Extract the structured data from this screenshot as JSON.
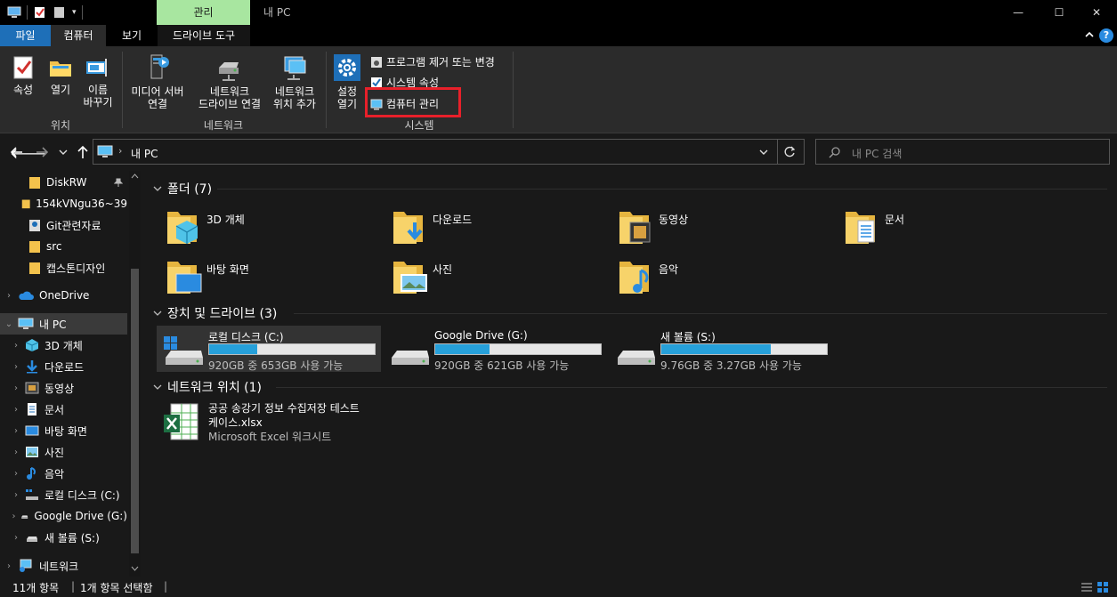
{
  "titlebar": {
    "manage_tab": "관리",
    "window_title": "내 PC",
    "minimize": "—",
    "maximize": "☐",
    "close": "✕"
  },
  "tabs": {
    "file": "파일",
    "computer": "컴퓨터",
    "view": "보기",
    "drive_tools": "드라이브 도구"
  },
  "ribbon": {
    "properties": "속성",
    "open": "열기",
    "rename_1": "이름",
    "rename_2": "바꾸기",
    "group_location": "위치",
    "media_server_1": "미디어 서버",
    "media_server_2": "연결",
    "network_drive_1": "네트워크",
    "network_drive_2": "드라이브 연결",
    "add_network_1": "네트워크",
    "add_network_2": "위치 추가",
    "group_network": "네트워크",
    "settings_1": "설정",
    "settings_2": "열기",
    "uninstall": "프로그램 제거 또는 변경",
    "system_properties": "시스템 속성",
    "computer_management": "컴퓨터 관리",
    "group_system": "시스템"
  },
  "nav": {
    "address": "내 PC",
    "search_placeholder": "내 PC 검색"
  },
  "sidebar": {
    "items": [
      {
        "label": "DiskRW"
      },
      {
        "label": "154kVNgu36~39"
      },
      {
        "label": "Git관련자료"
      },
      {
        "label": "src"
      },
      {
        "label": "캡스톤디자인"
      },
      {
        "label": "OneDrive"
      },
      {
        "label": "내 PC"
      },
      {
        "label": "3D 개체"
      },
      {
        "label": "다운로드"
      },
      {
        "label": "동영상"
      },
      {
        "label": "문서"
      },
      {
        "label": "바탕 화면"
      },
      {
        "label": "사진"
      },
      {
        "label": "음악"
      },
      {
        "label": "로컬 디스크 (C:)"
      },
      {
        "label": "Google Drive (G:)"
      },
      {
        "label": "새 볼륨 (S:)"
      },
      {
        "label": "네트워크"
      }
    ]
  },
  "main": {
    "folders_header": "폴더 (7)",
    "folders": [
      {
        "label": "3D 개체"
      },
      {
        "label": "다운로드"
      },
      {
        "label": "동영상"
      },
      {
        "label": "문서"
      },
      {
        "label": "바탕 화면"
      },
      {
        "label": "사진"
      },
      {
        "label": "음악"
      }
    ],
    "drives_header": "장치 및 드라이브 (3)",
    "drives": [
      {
        "name": "로컬 디스크 (C:)",
        "info": "920GB 중 653GB 사용 가능",
        "used_fraction": 0.29
      },
      {
        "name": "Google Drive (G:)",
        "info": "920GB 중 621GB 사용 가능",
        "used_fraction": 0.33
      },
      {
        "name": "새 볼륨 (S:)",
        "info": "9.76GB 중 3.27GB 사용 가능",
        "used_fraction": 0.66
      }
    ],
    "network_header": "네트워크 위치 (1)",
    "network_file": {
      "name_1": "공공 송강기 정보 수집저장 테스트",
      "name_2": "케이스.xlsx",
      "type": "Microsoft Excel 워크시트"
    }
  },
  "status": {
    "count": "11개 항목",
    "selected": "1개 항목 선택함"
  }
}
